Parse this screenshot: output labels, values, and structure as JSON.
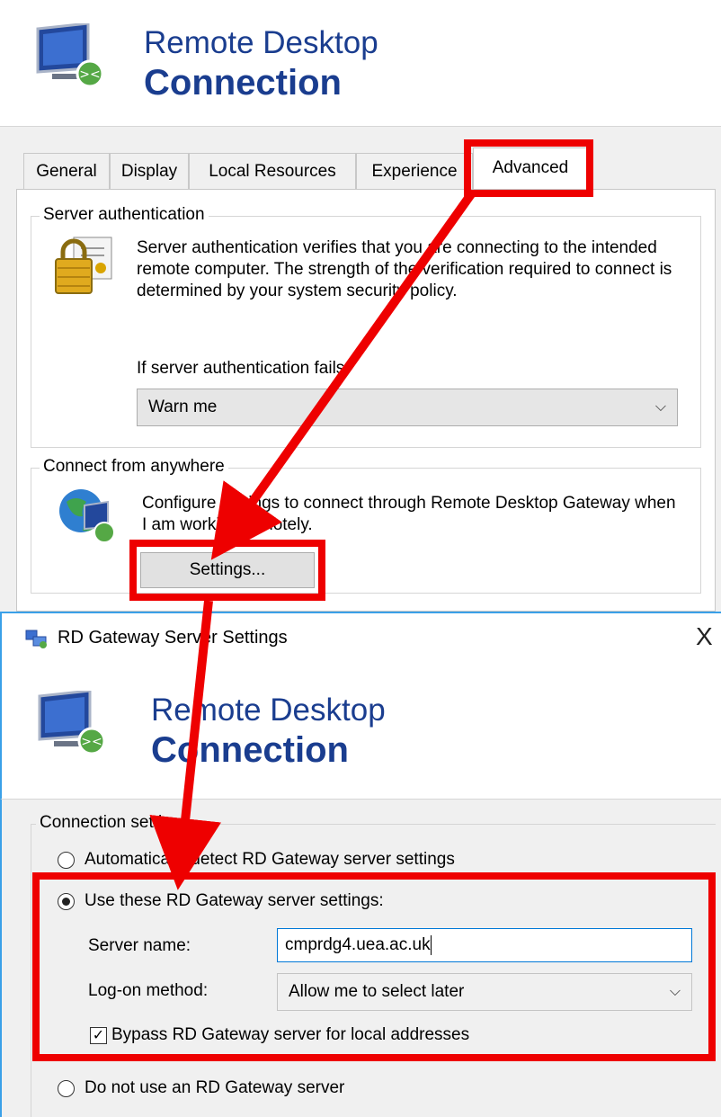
{
  "app": {
    "title_line1": "Remote Desktop",
    "title_line2": "Connection"
  },
  "tabs": [
    {
      "label": "General"
    },
    {
      "label": "Display"
    },
    {
      "label": "Local Resources"
    },
    {
      "label": "Experience"
    },
    {
      "label": "Advanced",
      "active": true
    }
  ],
  "server_auth": {
    "group_label": "Server authentication",
    "description": "Server authentication verifies that you are connecting to the intended remote computer. The strength of the verification required to connect is determined by your system security policy.",
    "fail_label": "If server authentication fails:",
    "fail_value": "Warn me",
    "icon": "lock-certificate-icon"
  },
  "connect_anywhere": {
    "group_label": "Connect from anywhere",
    "description": "Configure settings to connect through Remote Desktop Gateway when I am working remotely.",
    "settings_button": "Settings...",
    "icon": "globe-monitor-icon"
  },
  "dialog": {
    "title": "RD Gateway Server Settings",
    "close_glyph": "X",
    "banner_line1": "Remote Desktop",
    "banner_line2": "Connection",
    "connection_settings_label": "Connection settings",
    "radio_auto": "Automatically detect RD Gateway server settings",
    "radio_use": "Use these RD Gateway server settings:",
    "server_name_label": "Server name:",
    "server_name_value": "cmprdg4.uea.ac.uk",
    "logon_label": "Log-on method:",
    "logon_value": "Allow me to select later",
    "bypass_label": "Bypass RD Gateway server for local addresses",
    "bypass_checked": true,
    "radio_none": "Do not use an RD Gateway server",
    "selected_radio": "use"
  },
  "annotation": {
    "highlight_color": "#ee0000",
    "brand_color": "#1a3d8f",
    "titlebar_accent": "#3aa0e8"
  }
}
